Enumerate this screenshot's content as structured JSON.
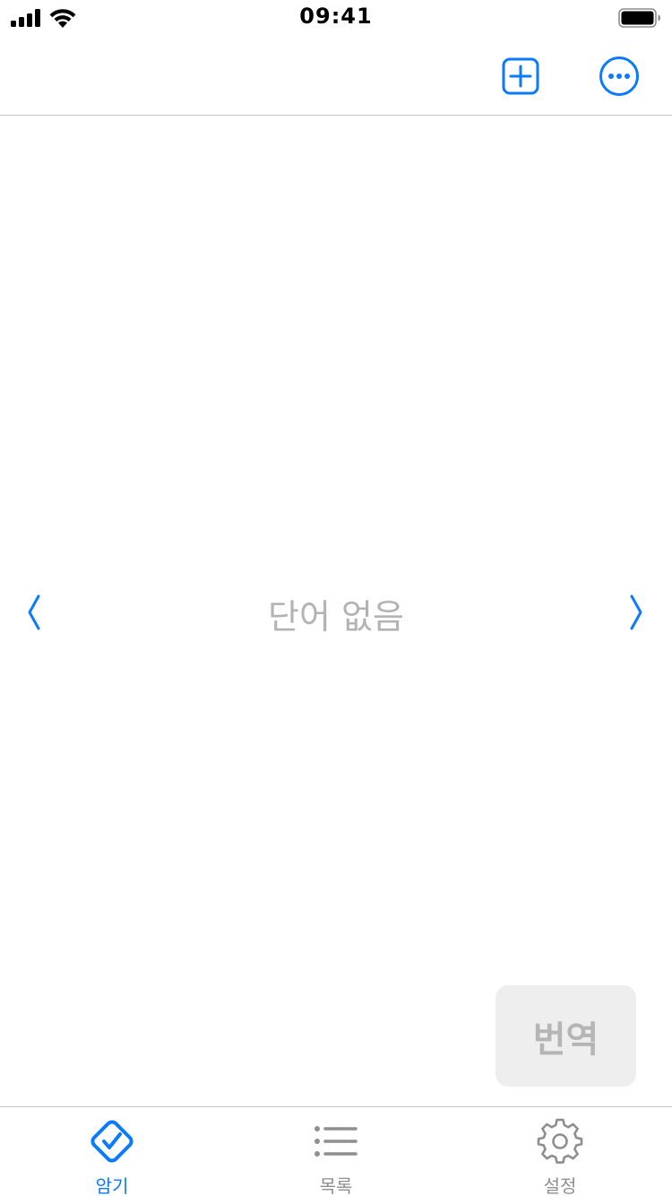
{
  "status_bar": {
    "time": "09:41",
    "signal_icon": "cellular-signal-icon",
    "wifi_icon": "wifi-icon",
    "battery_icon": "battery-icon"
  },
  "nav_bar": {
    "add_icon": "plus-square-icon",
    "more_icon": "ellipsis-circle-icon"
  },
  "main": {
    "empty_text": "단어 없음",
    "prev_icon": "chevron-left-icon",
    "next_icon": "chevron-right-icon",
    "translate_label": "번역"
  },
  "tab_bar": {
    "tabs": [
      {
        "label": "암기",
        "icon": "checkmark-diamond-icon",
        "active": true
      },
      {
        "label": "목록",
        "icon": "list-bullet-icon",
        "active": false
      },
      {
        "label": "설정",
        "icon": "gear-icon",
        "active": false
      }
    ]
  },
  "colors": {
    "accent": "#0a7aff",
    "inactive": "#8e8e93",
    "placeholder_text": "#b3b3b3",
    "button_bg": "#eeeeee",
    "divider": "#c6c6c8"
  }
}
